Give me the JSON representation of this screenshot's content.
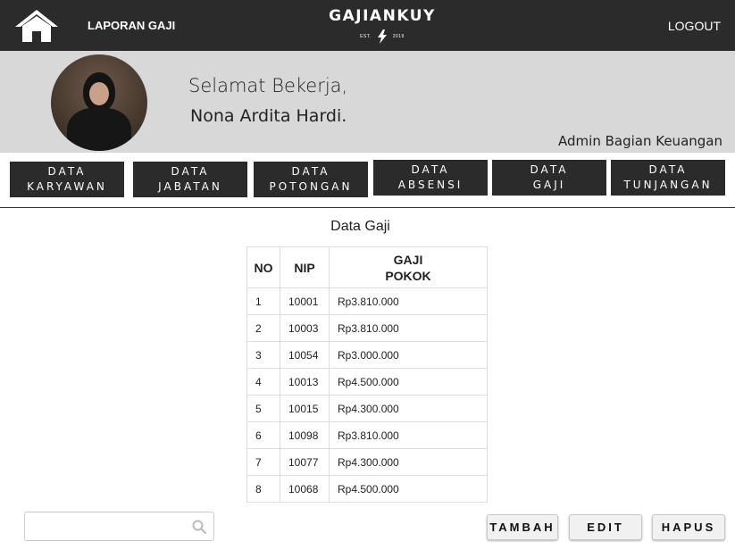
{
  "header": {
    "report_link": "LAPORAN GAJI",
    "brand_name": "GAJIANKUY",
    "brand_est": "EST.",
    "brand_year": "2019",
    "logout": "LOGOUT",
    "icons": {
      "home": "home-icon",
      "brand_mark": "bolt-icon"
    },
    "background_color": "#2b2b2b"
  },
  "profile": {
    "greeting": "Selamat Bekerja,",
    "name": "Nona Ardita Hardi.",
    "role": "Admin Bagian Keuangan",
    "background_color": "#d8d8d8"
  },
  "menu": [
    {
      "line1": "DATA",
      "line2": "KARYAWAN"
    },
    {
      "line1": "DATA",
      "line2": "JABATAN"
    },
    {
      "line1": "DATA",
      "line2": "POTONGAN"
    },
    {
      "line1": "DATA",
      "line2": "ABSENSI"
    },
    {
      "line1": "DATA",
      "line2": "GAJI"
    },
    {
      "line1": "DATA",
      "line2": "TUNJANGAN"
    }
  ],
  "content": {
    "title": "Data Gaji",
    "table": {
      "headers": {
        "no": "NO",
        "nip": "NIP",
        "gaji_line1": "GAJI",
        "gaji_line2": "POKOK"
      },
      "rows": [
        {
          "no": "1",
          "nip": "10001",
          "gaji": "Rp3.810.000"
        },
        {
          "no": "2",
          "nip": "10003",
          "gaji": "Rp3.810.000"
        },
        {
          "no": "3",
          "nip": "10054",
          "gaji": "Rp3.000.000"
        },
        {
          "no": "4",
          "nip": "10013",
          "gaji": "Rp4.500.000"
        },
        {
          "no": "5",
          "nip": "10015",
          "gaji": "Rp4.300.000"
        },
        {
          "no": "6",
          "nip": "10098",
          "gaji": "Rp3.810.000"
        },
        {
          "no": "7",
          "nip": "10077",
          "gaji": "Rp4.300.000"
        },
        {
          "no": "8",
          "nip": "10068",
          "gaji": "Rp4.500.000"
        }
      ]
    }
  },
  "search": {
    "value": "",
    "placeholder": "",
    "icon": "search-icon"
  },
  "actions": {
    "add": "TAMBAH",
    "edit": "EDIT",
    "delete": "HAPUS"
  }
}
